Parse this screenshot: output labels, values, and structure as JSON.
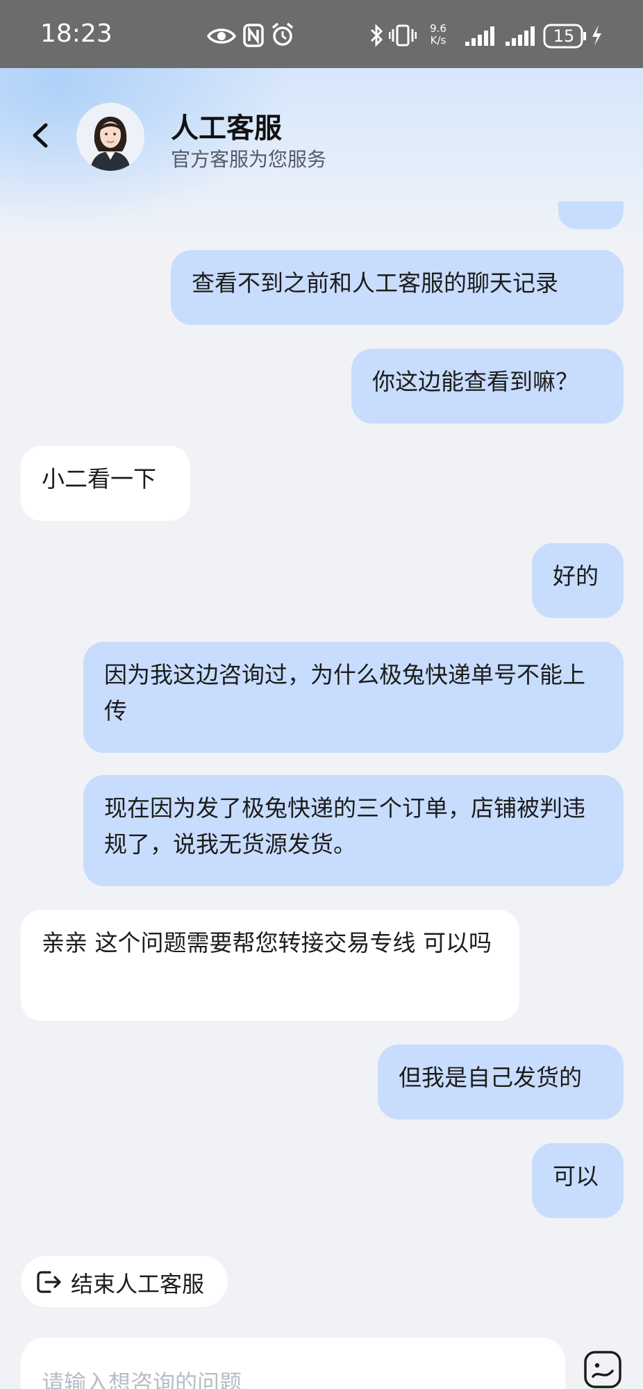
{
  "status_bar": {
    "time": "18:23",
    "net_speed_value": "9.6",
    "net_speed_unit": "K/s",
    "battery": "15",
    "icons": [
      "eye-comfort-icon",
      "nfc-icon",
      "alarm-icon",
      "bluetooth-icon",
      "vibrate-icon",
      "signal-icon",
      "signal-icon",
      "charging-icon"
    ]
  },
  "header": {
    "back_icon": "chevron-left-icon",
    "title": "人工客服",
    "subtitle": "官方客服为您服务"
  },
  "messages": [
    {
      "side": "out",
      "text": "查看不到之前和人工客服的聊天记录"
    },
    {
      "side": "out",
      "text": "你这边能查看到嘛？"
    },
    {
      "side": "in",
      "text": "小二看一下"
    },
    {
      "side": "out",
      "text": "好的"
    },
    {
      "side": "out",
      "text": "因为我这边咨询过，为什么极兔快递单号不能上传"
    },
    {
      "side": "out",
      "text": "现在因为发了极兔快递的三个订单，店铺被判违规了，说我无货源发货。"
    },
    {
      "side": "in",
      "text": "亲亲 这个问题需要帮您转接交易专线 可以吗"
    },
    {
      "side": "out",
      "text": "但我是自己发货的"
    },
    {
      "side": "out",
      "text": "可以"
    }
  ],
  "end_service": {
    "label": "结束人工客服",
    "icon": "exit-icon"
  },
  "input": {
    "placeholder": "请输入想咨询的问题",
    "value": ""
  },
  "sticker_button": {
    "icon": "sticker-icon"
  },
  "colors": {
    "outgoing_bubble": "#c8ddfd",
    "incoming_bubble": "#ffffff",
    "background": "#f1f2f6",
    "status_bar": "#6c6c6c"
  }
}
